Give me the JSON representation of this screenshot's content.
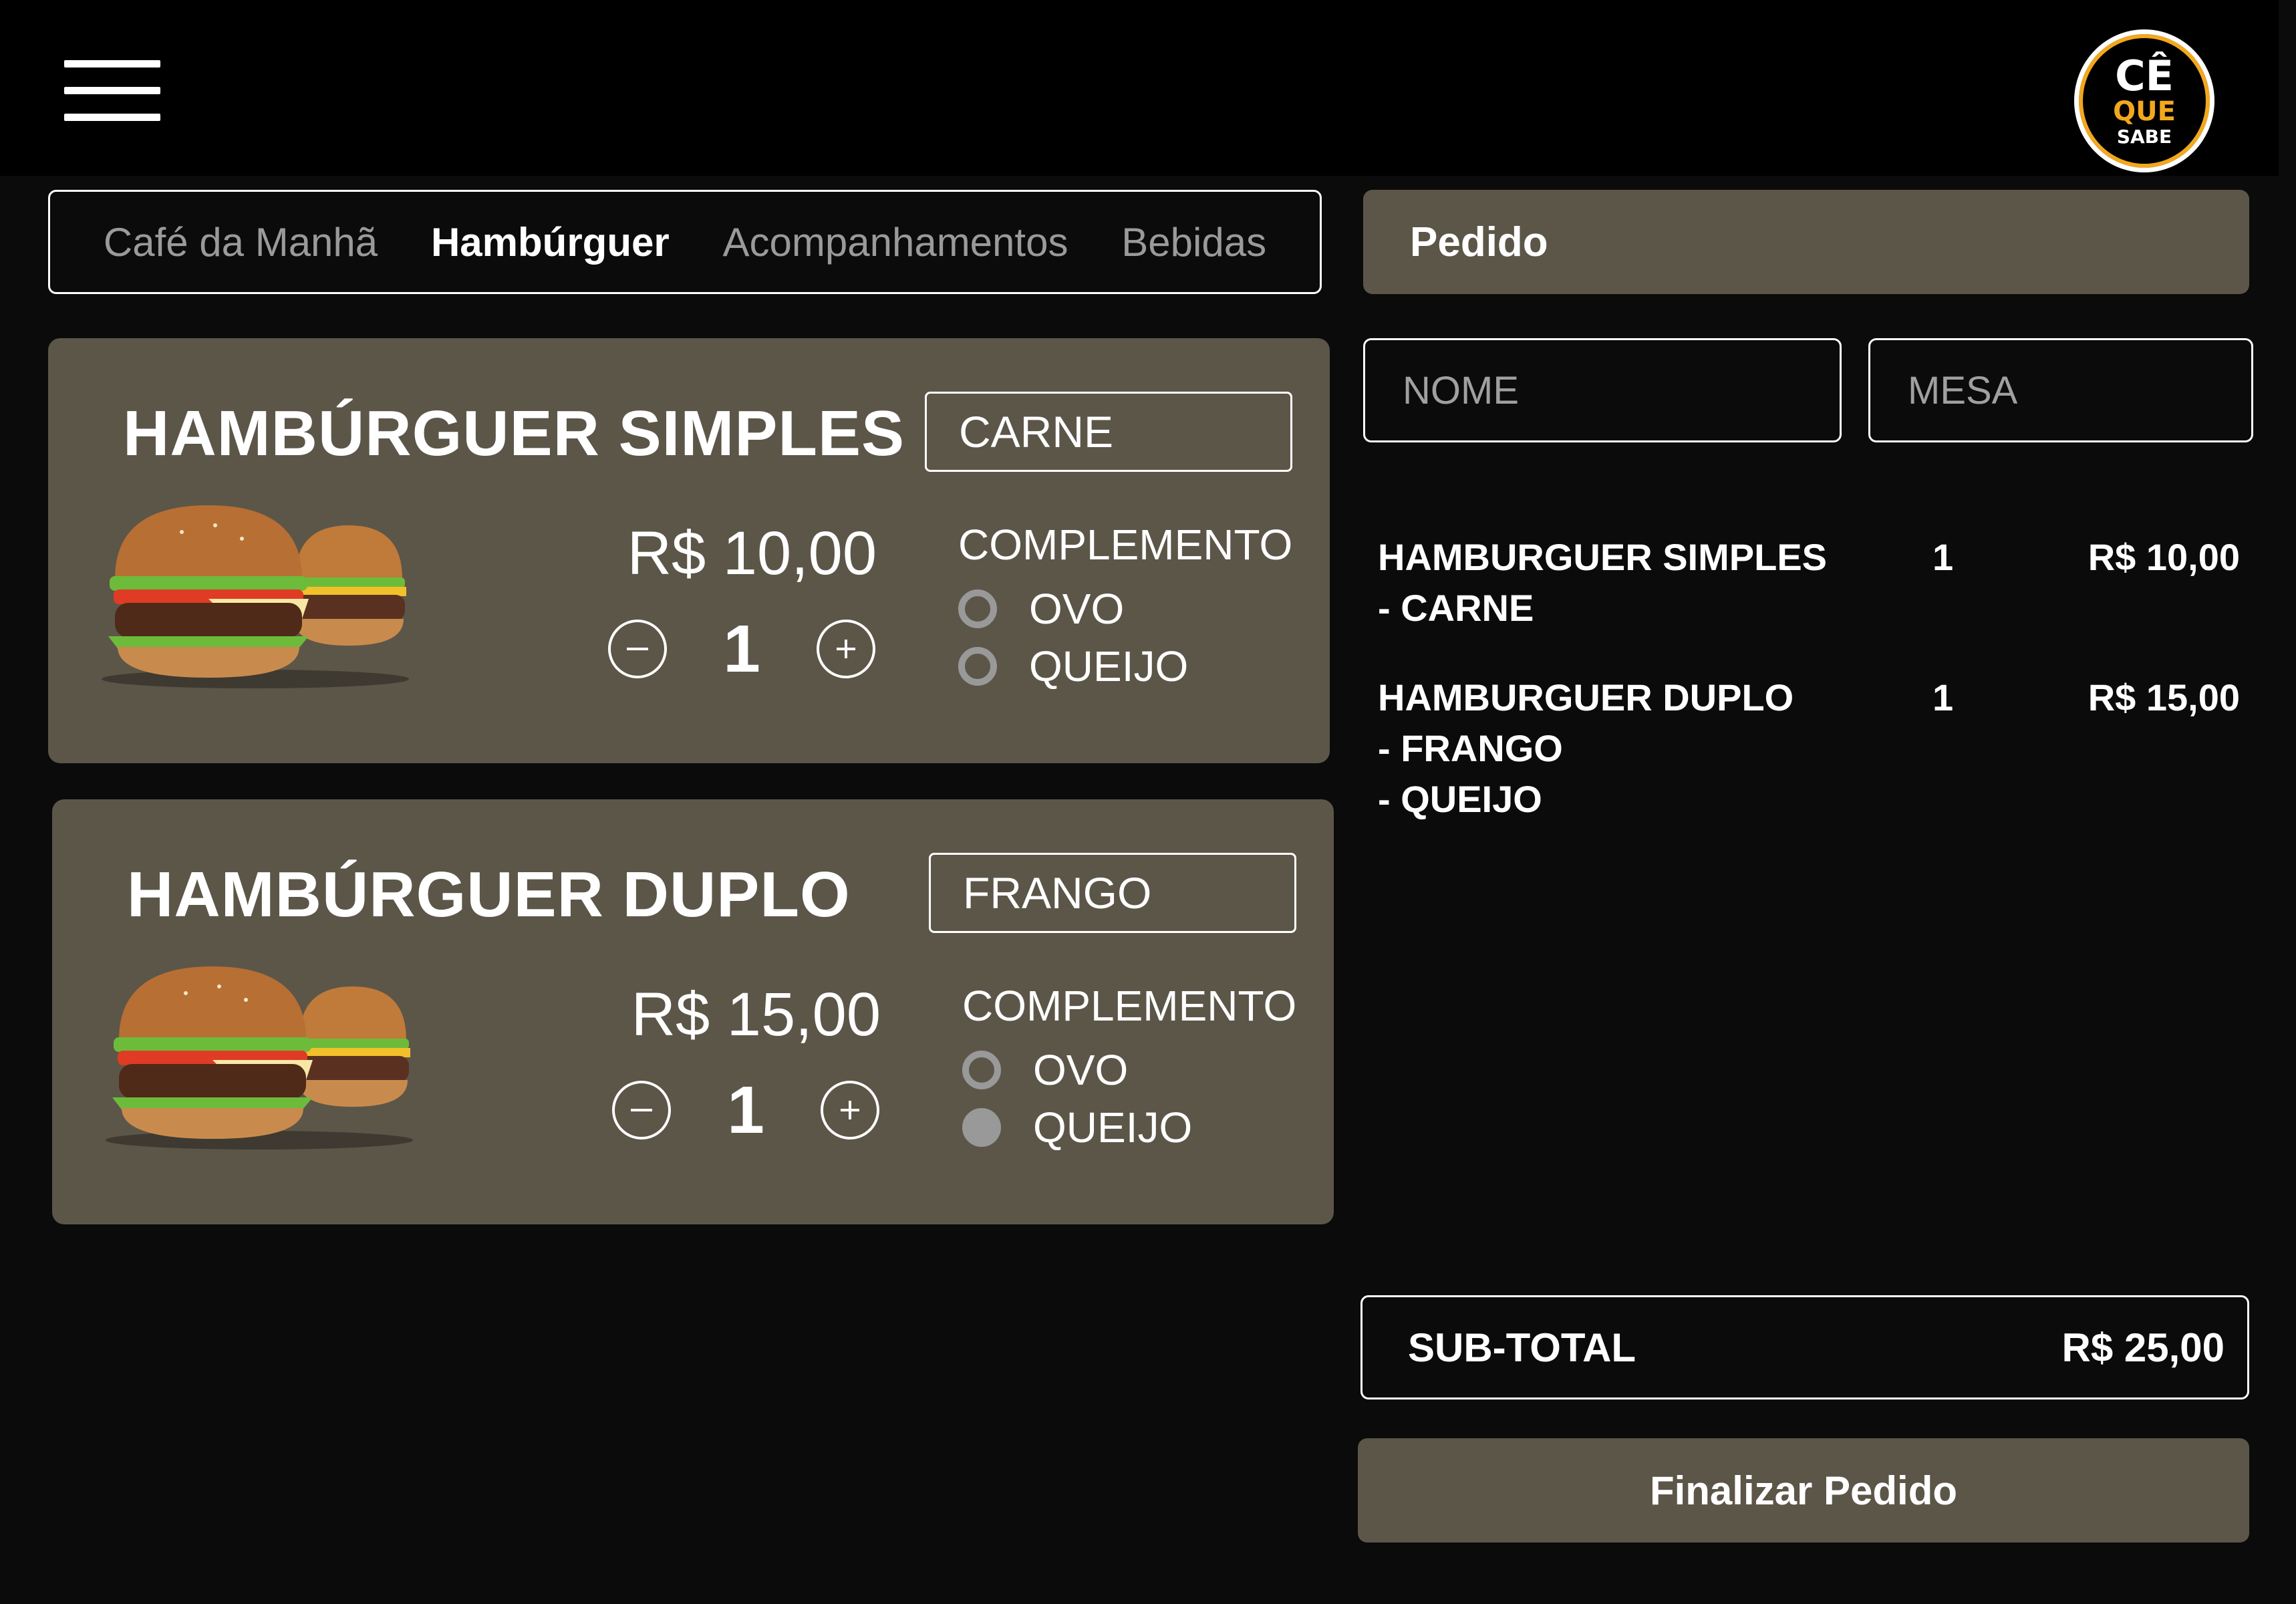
{
  "header": {
    "menu_icon": "hamburger-menu-icon",
    "logo": {
      "line1": "CÊ",
      "line2": "QUE",
      "line3": "SABE"
    }
  },
  "tabs": [
    {
      "label": "Café da Manhã",
      "active": false
    },
    {
      "label": "Hambúrguer",
      "active": true
    },
    {
      "label": "Acompanhamentos",
      "active": false
    },
    {
      "label": "Bebidas",
      "active": false
    }
  ],
  "products": [
    {
      "title": "HAMBÚRGUER SIMPLES",
      "price": "R$ 10,00",
      "quantity": "1",
      "protein": "CARNE",
      "complement_label": "COMPLEMENTO",
      "options": [
        {
          "label": "OVO",
          "selected": false
        },
        {
          "label": "QUEIJO",
          "selected": false
        }
      ]
    },
    {
      "title": "HAMBÚRGUER DUPLO",
      "price": "R$ 15,00",
      "quantity": "1",
      "protein": "FRANGO",
      "complement_label": "COMPLEMENTO",
      "options": [
        {
          "label": "OVO",
          "selected": false
        },
        {
          "label": "QUEIJO",
          "selected": true
        }
      ]
    }
  ],
  "order": {
    "title": "Pedido",
    "name_placeholder": "NOME",
    "table_placeholder": "MESA",
    "items": [
      {
        "line1": "HAMBURGUER SIMPLES",
        "line2": "- CARNE",
        "line3": "",
        "qty": "1",
        "price": "R$ 10,00"
      },
      {
        "line1": "HAMBURGUER DUPLO",
        "line2": "- FRANGO",
        "line3": "- QUEIJO",
        "qty": "1",
        "price": "R$ 15,00"
      }
    ],
    "subtotal_label": "SUB-TOTAL",
    "subtotal_value": "R$ 25,00",
    "finalize_label": "Finalizar Pedido"
  },
  "colors": {
    "background": "#0b0b0b",
    "card": "#5c5649",
    "accent": "#f2a81d",
    "radio": "#999999"
  }
}
